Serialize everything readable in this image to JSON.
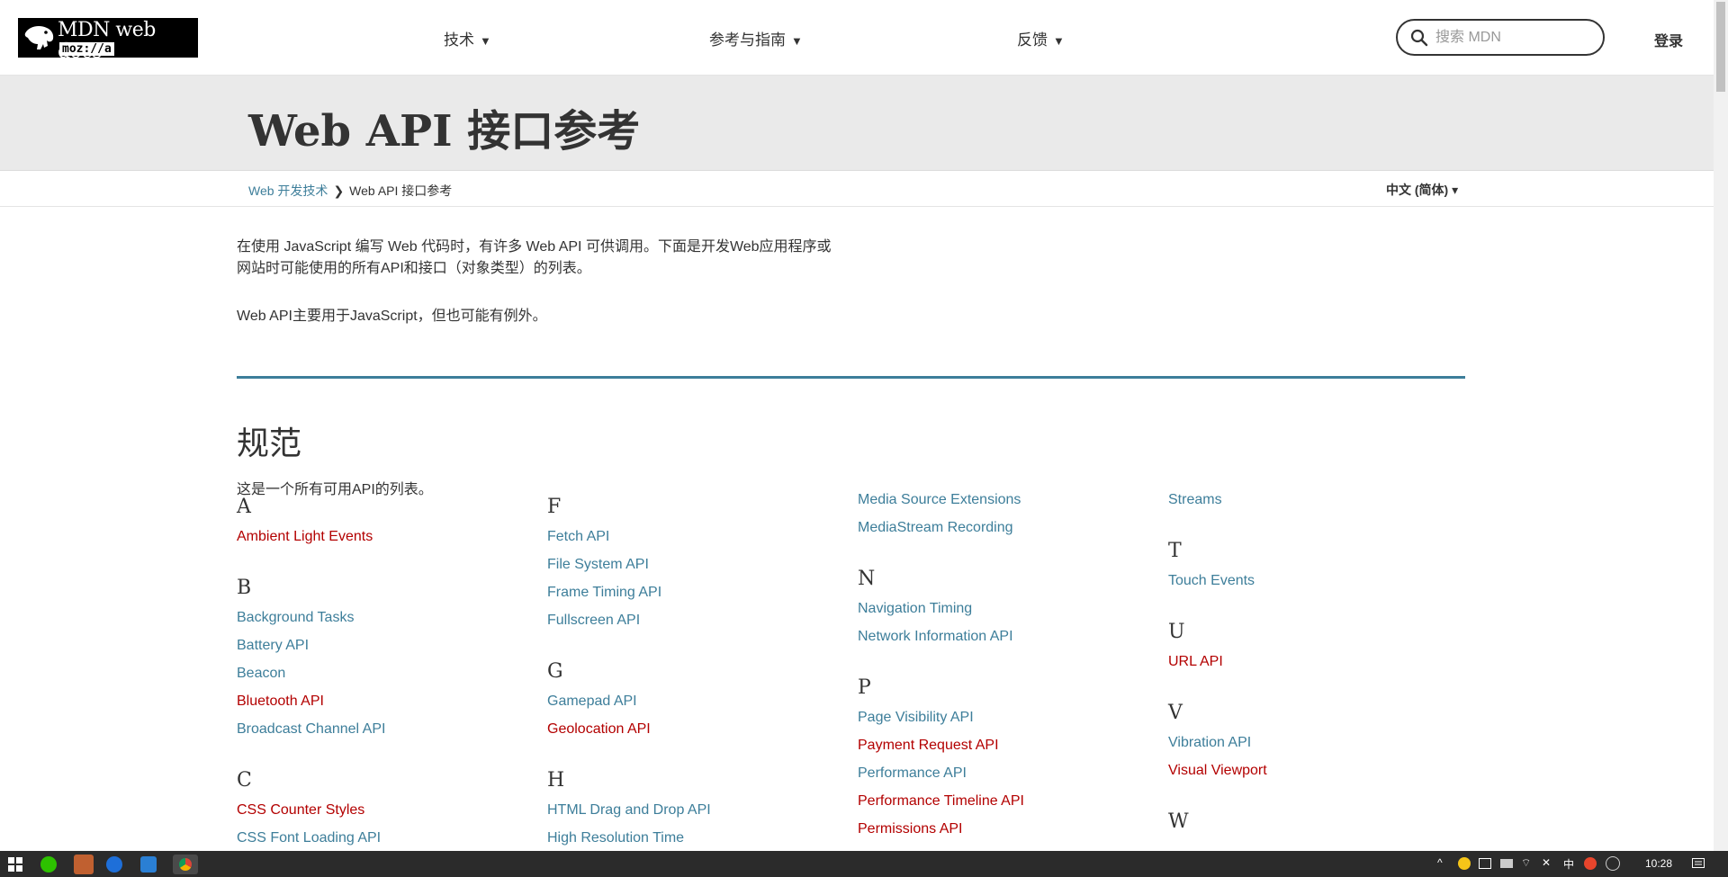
{
  "header": {
    "logo_title": "MDN web docs",
    "logo_sub": "moz://a",
    "nav": [
      {
        "label": "技术",
        "caret": "▼"
      },
      {
        "label": "参考与指南",
        "caret": "▼"
      },
      {
        "label": "反馈",
        "caret": "▼"
      }
    ],
    "search_placeholder": "搜索 MDN",
    "login": "登录"
  },
  "page": {
    "title": "Web API 接口参考",
    "breadcrumb": {
      "parent": "Web 开发技术",
      "separator": "❯",
      "current": "Web API 接口参考"
    },
    "language": "中文 (简体) ▾",
    "intro_line1": "在使用 JavaScript 编写 Web 代码时，有许多 Web API 可供调用。下面是开发Web应用程序或",
    "intro_line2": "网站时可能使用的所有API和接口（对象类型）的列表。",
    "intro_para2": "Web API主要用于JavaScript，但也可能有例外。",
    "section_title": "规范",
    "section_desc": "这是一个所有可用API的列表。"
  },
  "columns": [
    {
      "groups": [
        {
          "letter": "A",
          "items": [
            {
              "label": "Ambient Light Events",
              "color": "red"
            }
          ]
        },
        {
          "letter": "B",
          "items": [
            {
              "label": "Background Tasks",
              "color": "blue"
            },
            {
              "label": "Battery API",
              "color": "blue"
            },
            {
              "label": "Beacon",
              "color": "blue"
            },
            {
              "label": "Bluetooth API",
              "color": "red"
            },
            {
              "label": "Broadcast Channel API",
              "color": "blue"
            }
          ]
        },
        {
          "letter": "C",
          "items": [
            {
              "label": "CSS Counter Styles",
              "color": "red"
            },
            {
              "label": "CSS Font Loading API",
              "color": "blue"
            }
          ]
        }
      ]
    },
    {
      "groups": [
        {
          "letter": "F",
          "items": [
            {
              "label": "Fetch API",
              "color": "blue"
            },
            {
              "label": "File System API",
              "color": "blue"
            },
            {
              "label": "Frame Timing API",
              "color": "blue"
            },
            {
              "label": "Fullscreen API",
              "color": "blue"
            }
          ]
        },
        {
          "letter": "G",
          "items": [
            {
              "label": "Gamepad API",
              "color": "blue"
            },
            {
              "label": "Geolocation API",
              "color": "red"
            }
          ]
        },
        {
          "letter": "H",
          "items": [
            {
              "label": "HTML Drag and Drop API",
              "color": "blue"
            },
            {
              "label": "High Resolution Time",
              "color": "blue"
            }
          ]
        }
      ]
    },
    {
      "groups": [
        {
          "letter": "",
          "items": [
            {
              "label": "Media Source Extensions",
              "color": "blue"
            },
            {
              "label": "MediaStream Recording",
              "color": "blue"
            }
          ]
        },
        {
          "letter": "N",
          "items": [
            {
              "label": "Navigation Timing",
              "color": "blue"
            },
            {
              "label": "Network Information API",
              "color": "blue"
            }
          ]
        },
        {
          "letter": "P",
          "items": [
            {
              "label": "Page Visibility API",
              "color": "blue"
            },
            {
              "label": "Payment Request API",
              "color": "red"
            },
            {
              "label": "Performance API",
              "color": "blue"
            },
            {
              "label": "Performance Timeline API",
              "color": "red"
            },
            {
              "label": "Permissions API",
              "color": "red"
            }
          ]
        }
      ]
    },
    {
      "groups": [
        {
          "letter": "",
          "items": [
            {
              "label": "Streams",
              "color": "blue"
            }
          ]
        },
        {
          "letter": "T",
          "items": [
            {
              "label": "Touch Events",
              "color": "blue"
            }
          ]
        },
        {
          "letter": "U",
          "items": [
            {
              "label": "URL API",
              "color": "red"
            }
          ]
        },
        {
          "letter": "V",
          "items": [
            {
              "label": "Vibration API",
              "color": "blue"
            },
            {
              "label": "Visual Viewport",
              "color": "red"
            }
          ]
        },
        {
          "letter": "W",
          "items": []
        }
      ]
    }
  ],
  "taskbar": {
    "ime": "中",
    "clock": "10:28"
  },
  "colors": {
    "link": "#3d7e9a",
    "link_missing": "#b30000",
    "rule": "#3d7e9a",
    "title_band": "#eaeaea"
  }
}
